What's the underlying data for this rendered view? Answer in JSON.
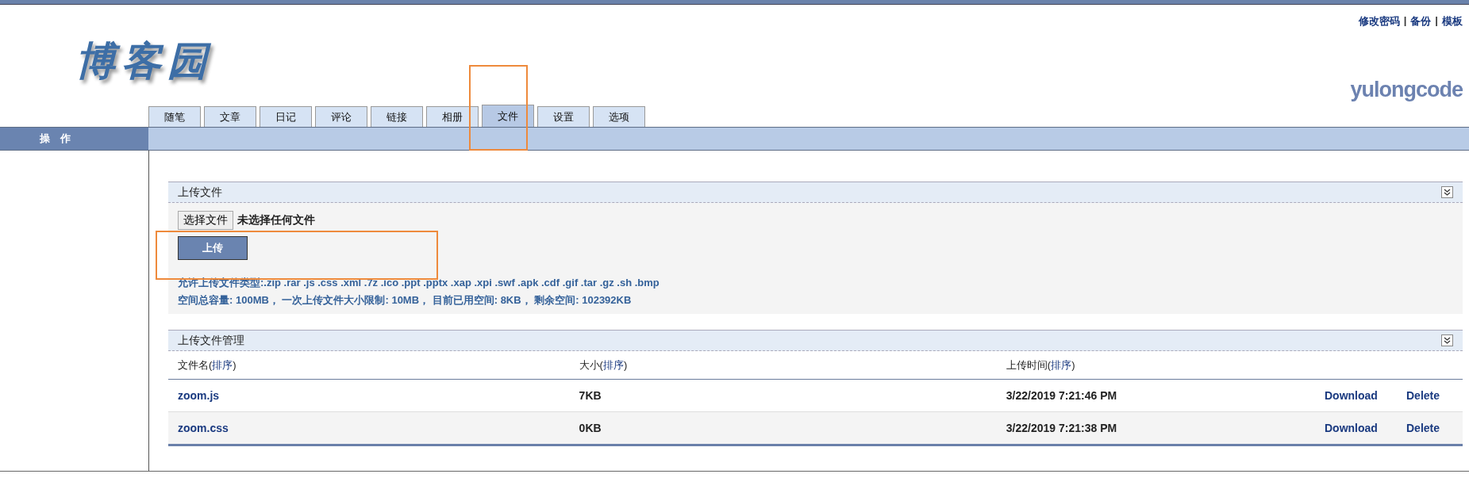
{
  "header": {
    "logo": "博客园",
    "links": [
      "修改密码",
      "备份",
      "模板"
    ],
    "separator": "|",
    "username": "yulongcode"
  },
  "tabs": [
    {
      "label": "随笔",
      "selected": false,
      "highlighted": false
    },
    {
      "label": "文章",
      "selected": false,
      "highlighted": false
    },
    {
      "label": "日记",
      "selected": false,
      "highlighted": false
    },
    {
      "label": "评论",
      "selected": false,
      "highlighted": false
    },
    {
      "label": "链接",
      "selected": false,
      "highlighted": false
    },
    {
      "label": "相册",
      "selected": false,
      "highlighted": false
    },
    {
      "label": "文件",
      "selected": true,
      "highlighted": true
    },
    {
      "label": "设置",
      "selected": false,
      "highlighted": false
    },
    {
      "label": "选项",
      "selected": false,
      "highlighted": false
    }
  ],
  "sidebar": {
    "title": "操　作"
  },
  "upload_panel": {
    "title": "上传文件",
    "choose_button": "选择文件",
    "file_status": "未选择任何文件",
    "upload_button": {
      "label": "上传",
      "highlighted": true
    },
    "allowed_types": "允许上传文件类型:.zip .rar .js .css .xml .7z .ico .ppt .pptx .xap .xpi .swf .apk .cdf .gif .tar .gz .sh .bmp",
    "quota": "空间总容量: 100MB， 一次上传文件大小限制: 10MB， 目前已用空间: 8KB， 剩余空间: 102392KB"
  },
  "files_panel": {
    "title": "上传文件管理",
    "columns": [
      "文件名(**排序**)",
      "大小(**排序**)",
      "上传时间(**排序**)"
    ],
    "rows": [
      {
        "name": "zoom.js",
        "size": "7KB",
        "time": "3/22/2019 7:21:46 PM",
        "download": "Download",
        "delete": "Delete"
      },
      {
        "name": "zoom.css",
        "size": "0KB",
        "time": "3/22/2019 7:21:38 PM",
        "download": "Download",
        "delete": "Delete"
      }
    ]
  }
}
